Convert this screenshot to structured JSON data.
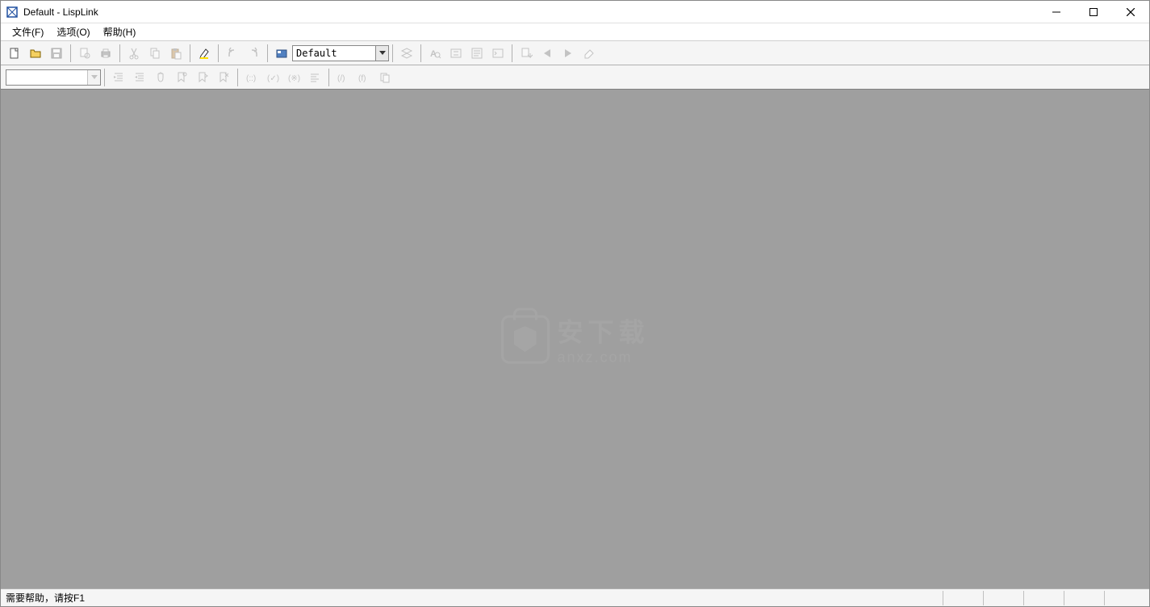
{
  "title": "Default - LispLink",
  "menu": {
    "file": "文件(F)",
    "options": "选项(O)",
    "help": "帮助(H)"
  },
  "toolbar1": {
    "combo_value": "Default"
  },
  "toolbar2": {
    "combo_value": ""
  },
  "watermark": {
    "text_main": "安下载",
    "text_sub": "anxz.com"
  },
  "status": {
    "help_text": "需要帮助，请按F1"
  }
}
